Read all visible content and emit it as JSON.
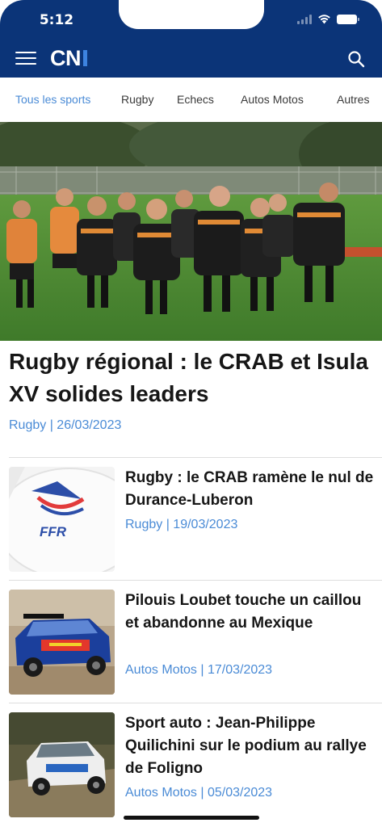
{
  "status_bar": {
    "time": "5:12"
  },
  "header": {
    "logo_text": "CN",
    "logo_name": "CNI",
    "brand_color": "#0b3478",
    "accent_color": "#4a8bd6",
    "menu_icon": "hamburger-menu-icon",
    "search_icon": "search-icon"
  },
  "tabs": [
    {
      "label": "Tous les sports",
      "active": true
    },
    {
      "label": "Rugby",
      "active": false
    },
    {
      "label": "Echecs",
      "active": false
    },
    {
      "label": "Autos Motos",
      "active": false
    },
    {
      "label": "Autres",
      "active": false
    }
  ],
  "hero": {
    "title": "Rugby régional : le CRAB et Isula XV solides leaders",
    "meta": "Rugby | 26/03/2023"
  },
  "articles": [
    {
      "title": "Rugby : le CRAB ramène le nul de Durance-Luberon",
      "meta": "Rugby | 19/03/2023"
    },
    {
      "title": "Pilouis Loubet touche un caillou et abandonne au Mexique",
      "meta": "Autos Motos | 17/03/2023"
    },
    {
      "title": "Sport auto : Jean-Philippe Quilichini sur le podium au rallye de Foligno",
      "meta": "Autos Motos | 05/03/2023"
    }
  ],
  "thumb_labels": {
    "ball_logo": "FFR"
  }
}
